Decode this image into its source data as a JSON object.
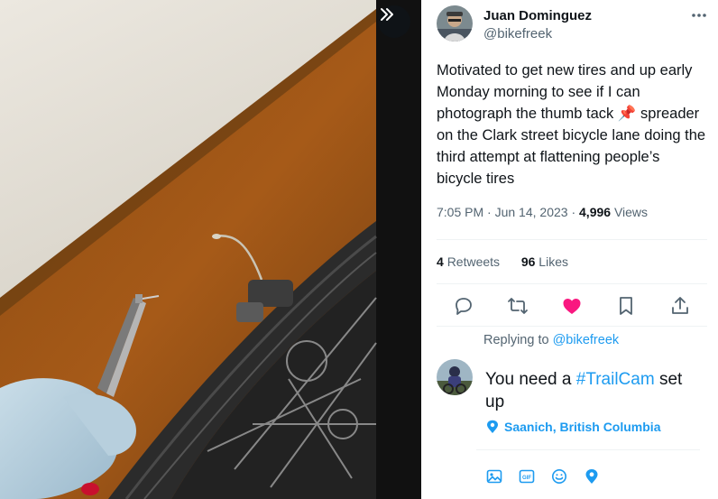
{
  "photo": {
    "expand_icon": "double-chevron-right-icon",
    "alt": ""
  },
  "tweet": {
    "author_name": "Juan Dominguez",
    "author_handle": "@bikefreek",
    "text_before_emoji": "Motivated to get new tires and up early Monday morning to see if I can photograph the thumb tack",
    "emoji": "📌",
    "text_after_emoji": "spreader on the Clark street bicycle lane doing the third attempt at flattening people’s bicycle tires",
    "time": "7:05 PM",
    "date": "Jun 14, 2023",
    "views_count": "4,996",
    "views_label": "Views",
    "retweets_count": "4",
    "retweets_label": "Retweets",
    "likes_count": "96",
    "likes_label": "Likes",
    "liked": true
  },
  "actions": [
    {
      "name": "reply-icon"
    },
    {
      "name": "retweet-icon"
    },
    {
      "name": "like-icon"
    },
    {
      "name": "bookmark-icon"
    },
    {
      "name": "share-icon"
    }
  ],
  "reply": {
    "replying_prefix": "Replying to",
    "replying_to": "@bikefreek",
    "text_before": "You need a",
    "hashtag": "#TrailCam",
    "text_after": "set up",
    "location": "Saanich, British Columbia",
    "tools": [
      "image-icon",
      "gif-icon",
      "emoji-icon",
      "location-icon"
    ]
  },
  "colors": {
    "accent": "#1d9bf0",
    "like": "#f91880",
    "text": "#0f1419",
    "muted": "#536471"
  }
}
